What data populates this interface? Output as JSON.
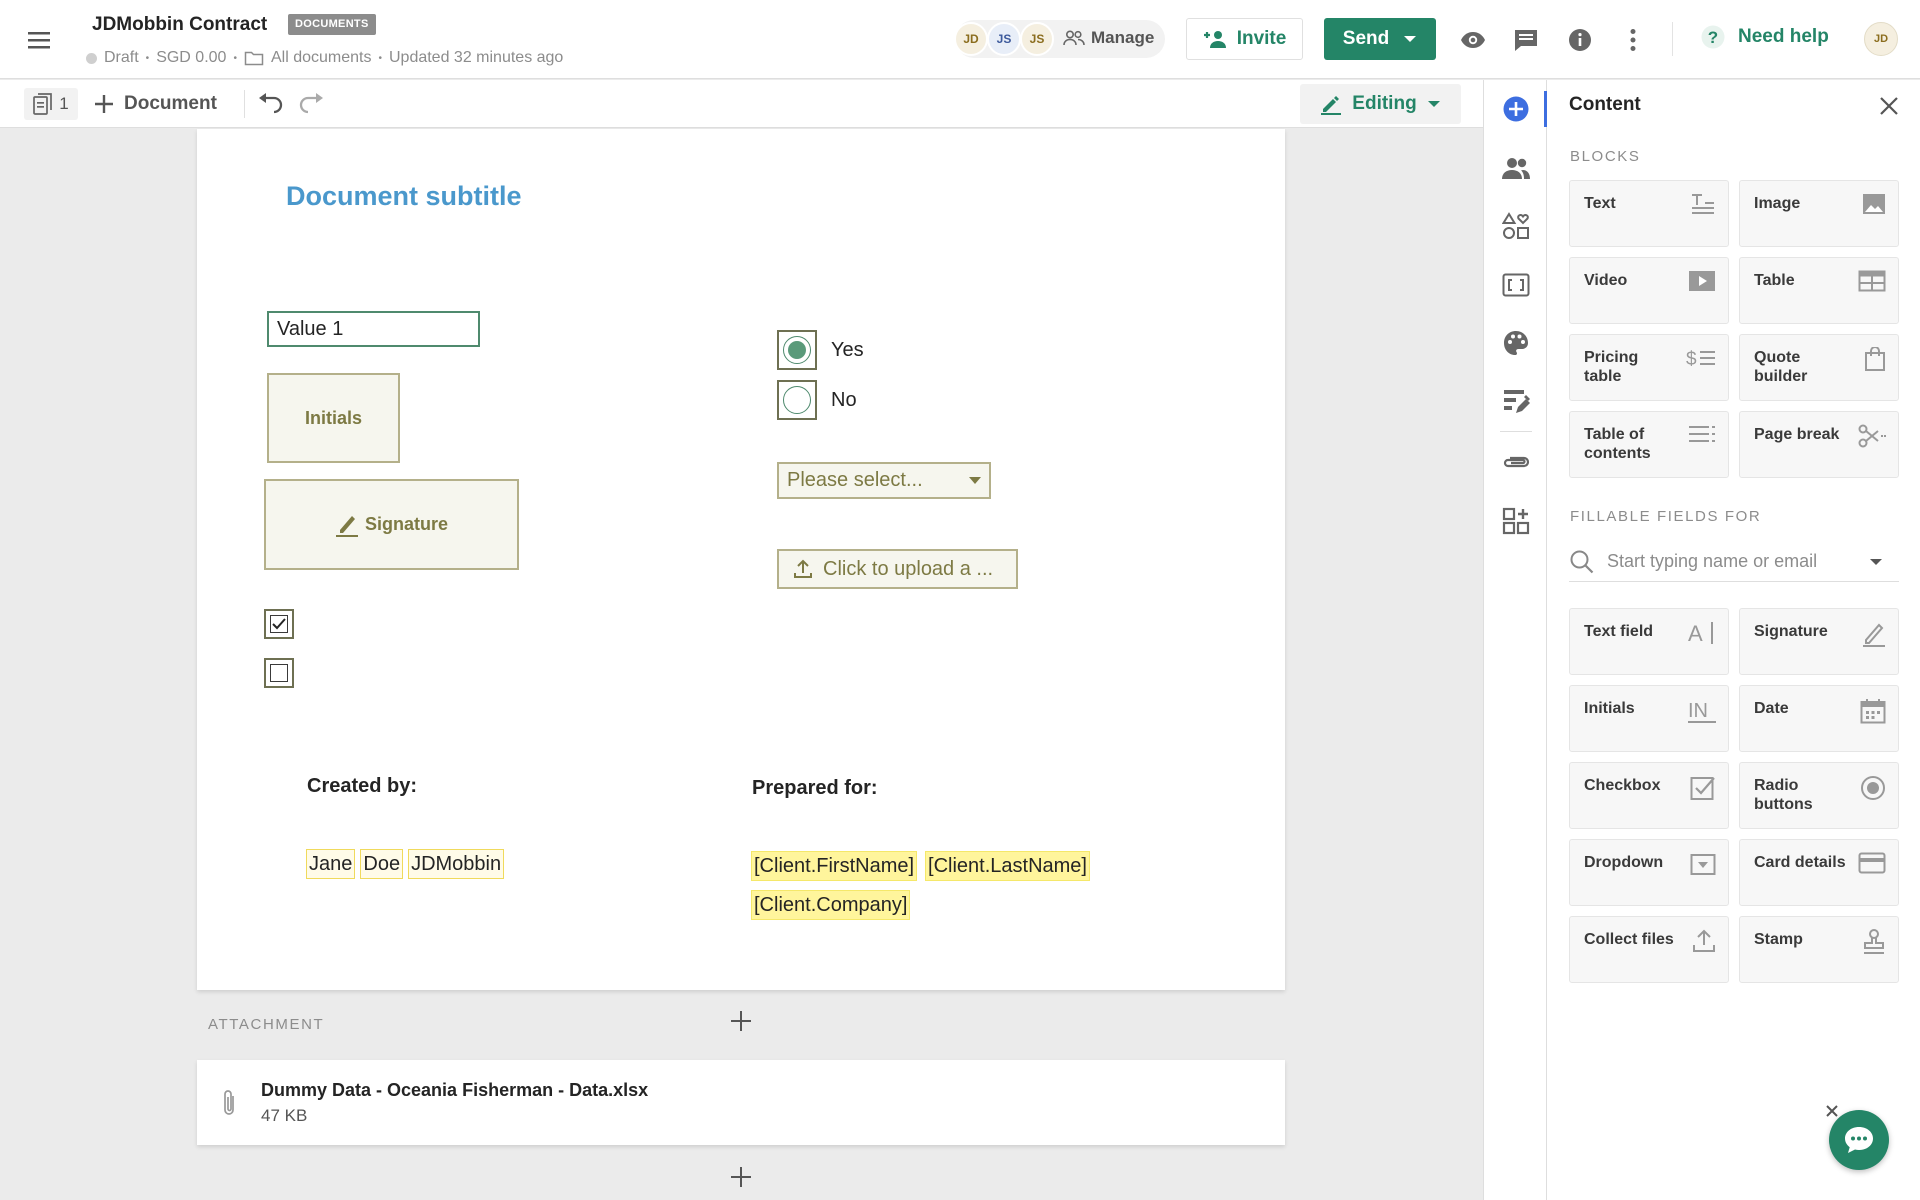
{
  "header": {
    "doc_title": "JDMobbin Contract",
    "badge": "DOCUMENTS",
    "status": "Draft",
    "amount": "SGD 0.00",
    "folder": "All documents",
    "updated": "Updated 32 minutes ago",
    "collaborators": [
      "JD",
      "JS",
      "JS"
    ],
    "manage_label": "Manage",
    "invite_label": "Invite",
    "send_label": "Send",
    "help_label": "Need help",
    "user_initials": "JD"
  },
  "toolbar": {
    "page_count": "1",
    "add_document_label": "Document",
    "mode_label": "Editing"
  },
  "document": {
    "subtitle": "Document subtitle",
    "text_field_value": "Value 1",
    "initials_label": "Initials",
    "signature_label": "Signature",
    "checkbox1_checked": true,
    "checkbox2_checked": false,
    "radio_options": [
      "Yes",
      "No"
    ],
    "radio_selected": "Yes",
    "dropdown_placeholder": "Please select...",
    "upload_label": "Click to upload a ...",
    "created_by_label": "Created by:",
    "prepared_for_label": "Prepared for:",
    "sender_first": "Jane",
    "sender_last": "Doe",
    "sender_company": "JDMobbin",
    "client_first": "[Client.FirstName]",
    "client_last": "[Client.LastName]",
    "client_company": "[Client.Company]"
  },
  "attachments": {
    "section_label": "ATTACHMENT",
    "file_name": "Dummy Data - Oceania Fisherman - Data.xlsx",
    "file_size": "47 KB"
  },
  "panel": {
    "title": "Content",
    "blocks_heading": "BLOCKS",
    "blocks": [
      {
        "label": "Text",
        "icon": "text-block-icon"
      },
      {
        "label": "Image",
        "icon": "image-block-icon"
      },
      {
        "label": "Video",
        "icon": "video-block-icon"
      },
      {
        "label": "Table",
        "icon": "table-block-icon"
      },
      {
        "label": "Pricing table",
        "icon": "pricing-table-icon"
      },
      {
        "label": "Quote builder",
        "icon": "quote-builder-icon"
      },
      {
        "label": "Table of contents",
        "icon": "table-of-contents-icon"
      },
      {
        "label": "Page break",
        "icon": "page-break-icon"
      }
    ],
    "fields_heading": "FILLABLE FIELDS FOR",
    "search_placeholder": "Start typing name or email",
    "fields": [
      {
        "label": "Text field",
        "icon": "text-field-icon"
      },
      {
        "label": "Signature",
        "icon": "signature-field-icon"
      },
      {
        "label": "Initials",
        "icon": "initials-field-icon"
      },
      {
        "label": "Date",
        "icon": "date-field-icon"
      },
      {
        "label": "Checkbox",
        "icon": "checkbox-field-icon"
      },
      {
        "label": "Radio buttons",
        "icon": "radio-field-icon"
      },
      {
        "label": "Dropdown",
        "icon": "dropdown-field-icon"
      },
      {
        "label": "Card details",
        "icon": "card-details-icon"
      },
      {
        "label": "Collect files",
        "icon": "collect-files-icon"
      },
      {
        "label": "Stamp",
        "icon": "stamp-icon"
      }
    ]
  },
  "colors": {
    "brand_green": "#248567",
    "subtitle_blue": "#4a98cc",
    "variable_highlight": "#fff59c",
    "active_blue": "#3d6ee0"
  }
}
